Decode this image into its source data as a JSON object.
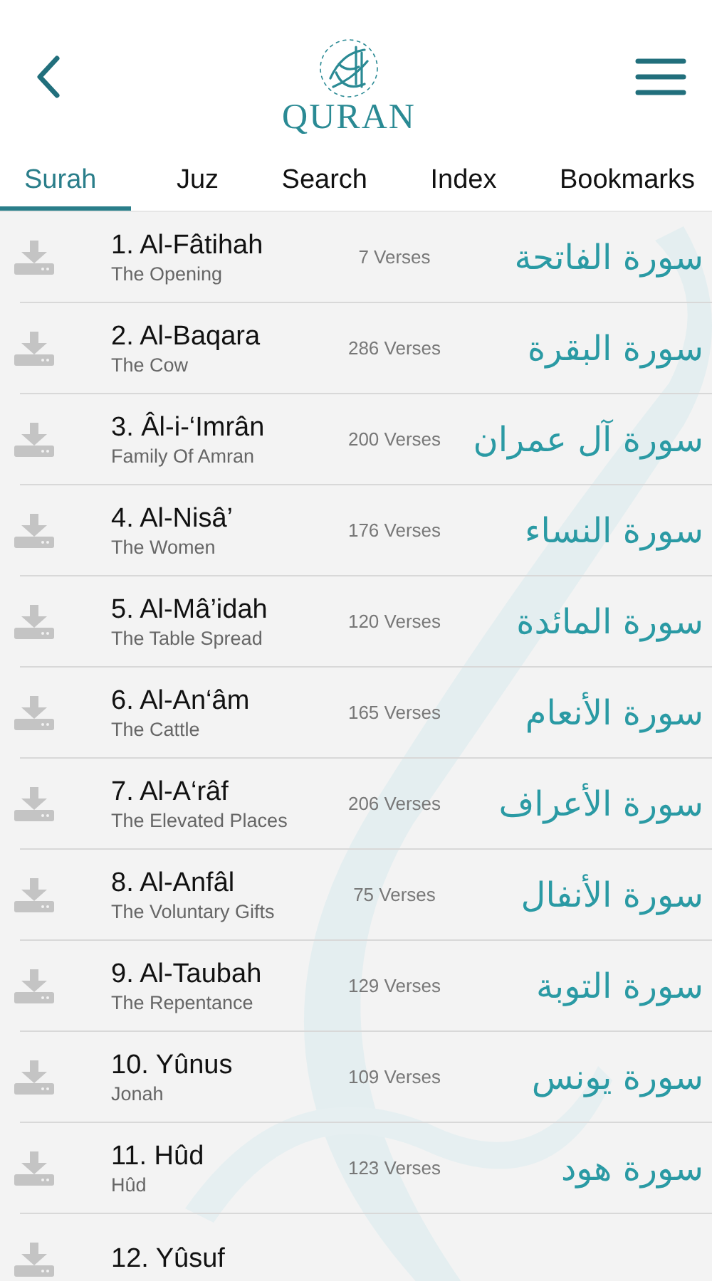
{
  "header": {
    "title": "QURAN"
  },
  "tabs": [
    {
      "label": "Surah",
      "selected": true
    },
    {
      "label": "Juz",
      "selected": false
    },
    {
      "label": "Search",
      "selected": false
    },
    {
      "label": "Index",
      "selected": false
    },
    {
      "label": "Bookmarks",
      "selected": false
    }
  ],
  "surahs": [
    {
      "name": "1. Al-Fâtihah",
      "meaning": "The Opening",
      "verses": "7 Verses",
      "arabic": "سورة الفاتحة"
    },
    {
      "name": "2. Al-Baqara",
      "meaning": "The Cow",
      "verses": "286 Verses",
      "arabic": "سورة البقرة"
    },
    {
      "name": "3. Âl-i-‘Imrân",
      "meaning": "Family Of Amran",
      "verses": "200 Verses",
      "arabic": "سورة آل عمران"
    },
    {
      "name": "4. Al-Nisâ’",
      "meaning": "The Women",
      "verses": "176 Verses",
      "arabic": "سورة النساء"
    },
    {
      "name": "5. Al-Mâ’idah",
      "meaning": "The Table Spread",
      "verses": "120 Verses",
      "arabic": "سورة المائدة"
    },
    {
      "name": "6. Al-An‘âm",
      "meaning": "The Cattle",
      "verses": "165 Verses",
      "arabic": "سورة الأنعام"
    },
    {
      "name": "7. Al-A‘râf",
      "meaning": "The Elevated Places",
      "verses": "206 Verses",
      "arabic": "سورة الأعراف"
    },
    {
      "name": "8. Al-Anfâl",
      "meaning": "The Voluntary Gifts",
      "verses": "75 Verses",
      "arabic": "سورة الأنفال"
    },
    {
      "name": "9. Al-Taubah",
      "meaning": "The Repentance",
      "verses": "129 Verses",
      "arabic": "سورة التوبة"
    },
    {
      "name": "10. Yûnus",
      "meaning": "Jonah",
      "verses": "109 Verses",
      "arabic": "سورة يونس"
    },
    {
      "name": "11. Hûd",
      "meaning": "Hûd",
      "verses": "123 Verses",
      "arabic": "سورة هود"
    },
    {
      "name": "12. Yûsuf"
    }
  ]
}
